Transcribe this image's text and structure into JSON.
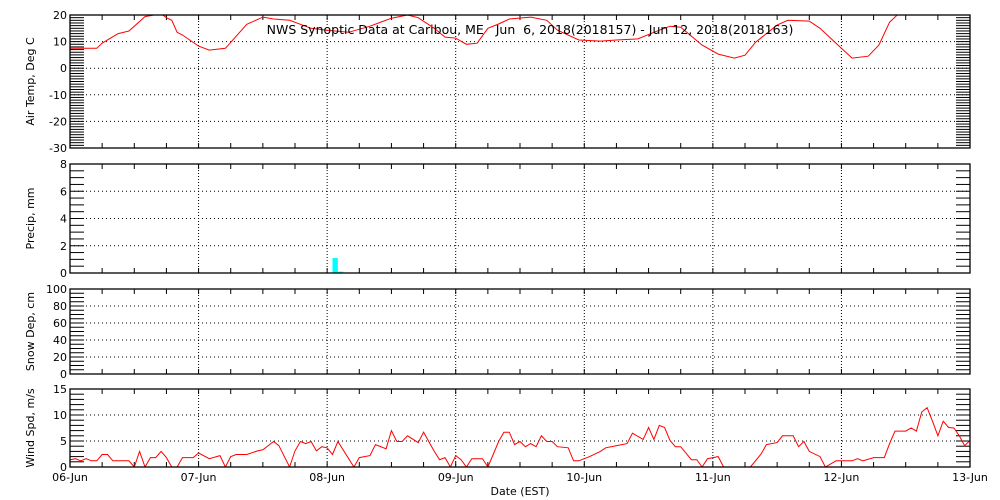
{
  "chart_data": [
    {
      "type": "line",
      "title": "NWS Synoptic Data at Caribou, ME   Jun  6, 2018(2018157) - Jun 12, 2018(2018163)",
      "ylabel": "Air Temp, Deg C",
      "ylim": [
        -30,
        20
      ],
      "yticks": [
        "-30",
        "-20",
        "-10",
        "0",
        "10",
        "20"
      ],
      "ytick_values": [
        -30,
        -20,
        -10,
        0,
        10,
        20
      ],
      "minor_step": 1,
      "color": "#ff0000",
      "x_hours": [
        0,
        5,
        6,
        9,
        11,
        14,
        17,
        18,
        19,
        20,
        21,
        24,
        26,
        29,
        31,
        33,
        36,
        38,
        41,
        45,
        48,
        52,
        56,
        60,
        63,
        65,
        68,
        70,
        72,
        74,
        76,
        78,
        80,
        82,
        86,
        89,
        91,
        95,
        99,
        102,
        106,
        110,
        112,
        114,
        118,
        121,
        124,
        126,
        128,
        132,
        134,
        138,
        140,
        144,
        146,
        149,
        151,
        153,
        156,
        162,
        168
      ],
      "values": [
        7.5,
        7.5,
        9.4,
        13,
        14,
        19.4,
        20.5,
        19,
        18,
        13.5,
        12.5,
        8.3,
        6.8,
        7.5,
        12,
        16.5,
        19.2,
        18.5,
        18,
        15,
        14.3,
        13.5,
        15.8,
        18.8,
        20,
        19,
        15,
        11.7,
        11.3,
        9,
        9.4,
        15,
        16.6,
        18.5,
        19.2,
        18,
        14.3,
        10.6,
        10.2,
        10.6,
        11,
        14.3,
        15.8,
        15.4,
        8.7,
        5.3,
        3.8,
        4.9,
        9.8,
        16.2,
        18,
        17.7,
        15,
        7.5,
        3.8,
        4.5,
        8.7,
        17.3,
        23,
        24,
        22
      ]
    },
    {
      "type": "bar",
      "ylabel": "Precip, mm",
      "ylim": [
        0,
        8
      ],
      "yticks": [
        "0",
        "2",
        "4",
        "6",
        "8"
      ],
      "ytick_values": [
        0,
        2,
        4,
        6,
        8
      ],
      "minor_step": 0.5,
      "color": "#00ffff",
      "bars": [
        {
          "start_hour": 49,
          "end_hour": 50,
          "value": 1.1
        },
        {
          "start_hour": 50,
          "end_hour": 51,
          "value": 0.1
        }
      ]
    },
    {
      "type": "line",
      "ylabel": "Snow Dep, cm",
      "ylim": [
        0,
        100
      ],
      "yticks": [
        "0",
        "20",
        "40",
        "60",
        "80",
        "100"
      ],
      "ytick_values": [
        0,
        20,
        40,
        60,
        80,
        100
      ],
      "minor_step": 5,
      "x_hours": [],
      "values": []
    },
    {
      "type": "line",
      "ylabel": "Wind Spd, m/s",
      "xlabel": "Date (EST)",
      "ylim": [
        0,
        15
      ],
      "yticks": [
        "0",
        "5",
        "10",
        "15"
      ],
      "ytick_values": [
        0,
        5,
        10,
        15
      ],
      "minor_step": 1,
      "color": "#ff0000",
      "x_hours": [
        0,
        1,
        2,
        3,
        4,
        5,
        6,
        7,
        8,
        11,
        12,
        13,
        14,
        15,
        16,
        17,
        18,
        19,
        20,
        21,
        23,
        24,
        26,
        28,
        29,
        30,
        31,
        33,
        35,
        36,
        38,
        39,
        41,
        42,
        43,
        44,
        45,
        46,
        47,
        48,
        49,
        50,
        53,
        54,
        56,
        57,
        59,
        60,
        61,
        62,
        63,
        65,
        66,
        68,
        69,
        70,
        71,
        72,
        73,
        74,
        75,
        77,
        78,
        79,
        80,
        81,
        82,
        83,
        84,
        85,
        86,
        87,
        88,
        89,
        90,
        91,
        93,
        94,
        95,
        97,
        99,
        100,
        101,
        103,
        104,
        105,
        107,
        108,
        109,
        110,
        111,
        112,
        113,
        114,
        116,
        117,
        118,
        119,
        121,
        122,
        127,
        129,
        130,
        132,
        133,
        135,
        136,
        137,
        138,
        140,
        141,
        143,
        146,
        147,
        148,
        150,
        152,
        153,
        154,
        156,
        157,
        158,
        159,
        160,
        161,
        162,
        163,
        164,
        165,
        166,
        167,
        168
      ],
      "values": [
        1.4,
        1.6,
        1.2,
        1.6,
        1.2,
        1.2,
        2.4,
        2.4,
        1.2,
        1.2,
        0,
        3,
        0,
        1.8,
        1.8,
        3,
        1.8,
        0,
        0,
        1.8,
        1.8,
        2.7,
        1.6,
        2.2,
        0,
        2,
        2.4,
        2.4,
        3.1,
        3.3,
        4.9,
        4.1,
        0,
        3.1,
        4.9,
        4.5,
        4.9,
        3.1,
        3.9,
        3.7,
        2.4,
        4.9,
        0,
        1.8,
        2.2,
        4.3,
        3.5,
        7,
        4.9,
        4.9,
        6,
        4.7,
        6.7,
        3,
        1.4,
        1.8,
        0,
        2.2,
        1.4,
        0,
        1.6,
        1.6,
        0,
        2.4,
        4.9,
        6.7,
        6.7,
        4.3,
        4.9,
        3.9,
        4.5,
        3.9,
        6,
        4.9,
        4.9,
        3.9,
        3.7,
        1.2,
        1.2,
        2,
        3,
        3.7,
        3.9,
        4.3,
        4.5,
        6.5,
        5.3,
        7.6,
        5.3,
        8,
        7.6,
        5.1,
        3.9,
        3.9,
        1.4,
        1.4,
        0,
        1.6,
        2,
        0,
        0,
        2.5,
        4.3,
        4.7,
        6,
        6,
        3.9,
        4.9,
        3,
        2,
        0,
        1.2,
        1.2,
        1.6,
        1.2,
        1.8,
        1.8,
        4.5,
        6.9,
        6.9,
        7.5,
        6.9,
        10.6,
        11.4,
        8.8,
        6,
        8.8,
        7.6,
        7.5,
        6,
        4.1,
        5.1
      ]
    }
  ],
  "x_axis": {
    "range_hours": [
      0,
      168
    ],
    "tick_labels": [
      "06-Jun",
      "07-Jun",
      "08-Jun",
      "09-Jun",
      "10-Jun",
      "11-Jun",
      "12-Jun",
      "13-Jun"
    ],
    "minor_step_hours": 6
  }
}
